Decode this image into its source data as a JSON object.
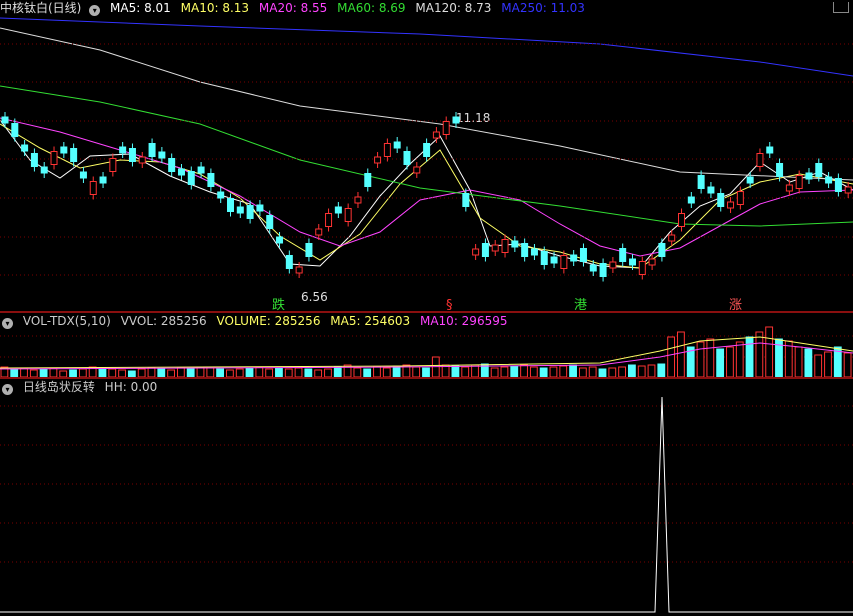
{
  "price_pane": {
    "title": "中核钛白(日线)",
    "indicators": [
      {
        "label": "MA5: 8.01",
        "color": "#ffffff"
      },
      {
        "label": "MA10: 8.13",
        "color": "#ffff66"
      },
      {
        "label": "MA20: 8.55",
        "color": "#ff44ff"
      },
      {
        "label": "MA60: 8.69",
        "color": "#33dd33"
      },
      {
        "label": "MA120: 8.73",
        "color": "#dddddd"
      },
      {
        "label": "MA250: 11.03",
        "color": "#3333ff"
      }
    ],
    "high_label": "11.18",
    "low_label": "6.56",
    "markers": [
      {
        "text": "跌",
        "color": "#33dd33"
      },
      {
        "text": "§",
        "color": "#ff3333"
      },
      {
        "text": "港",
        "color": "#33dd33"
      },
      {
        "text": "涨",
        "color": "#ff5555"
      }
    ]
  },
  "vol_pane": {
    "indicators": [
      {
        "label": "VOL-TDX(5,10)",
        "color": "#cccccc"
      },
      {
        "label": "VVOL: 285256",
        "color": "#cccccc"
      },
      {
        "label": "VOLUME: 285256",
        "color": "#ffff66"
      },
      {
        "label": "MA5: 254603",
        "color": "#ffff66"
      },
      {
        "label": "MA10: 296595",
        "color": "#ff44ff"
      }
    ]
  },
  "ind_pane": {
    "indicators": [
      {
        "label": "日线岛状反转",
        "color": "#cccccc"
      },
      {
        "label": "HH: 0.00",
        "color": "#cccccc"
      }
    ]
  },
  "colors": {
    "up": "#ff3333",
    "down": "#55ffff",
    "grid": "#7a0000",
    "bg": "#000000"
  }
}
